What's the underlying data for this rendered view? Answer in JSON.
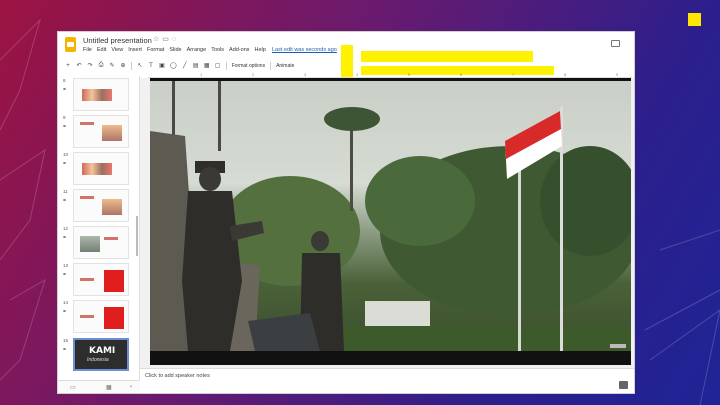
{
  "window": {
    "doc_title": "Untitled presentation",
    "title_icons": [
      "star-icon",
      "folder-icon",
      "cloud-icon"
    ],
    "last_edit": "Last edit was seconds ago"
  },
  "menu": [
    "File",
    "Edit",
    "View",
    "Insert",
    "Format",
    "Slide",
    "Arrange",
    "Tools",
    "Add-ons",
    "Help"
  ],
  "toolbar": {
    "format_options": "Format options",
    "animate": "Animate"
  },
  "ruler": [
    "1",
    "2",
    "3",
    "4",
    "5",
    "6",
    "7",
    "8",
    "9"
  ],
  "filmstrip": {
    "slides": [
      {
        "num": "8",
        "kind": "figures"
      },
      {
        "num": "9",
        "kind": "text-figure"
      },
      {
        "num": "10",
        "kind": "figures"
      },
      {
        "num": "11",
        "kind": "text-figure"
      },
      {
        "num": "12",
        "kind": "photo-text"
      },
      {
        "num": "13",
        "kind": "red-card"
      },
      {
        "num": "14",
        "kind": "red-card"
      },
      {
        "num": "15",
        "kind": "kami",
        "title": "KAMI",
        "subtitle": "Indonesia"
      }
    ]
  },
  "main": {
    "speaker_notes": "Click to add speaker notes"
  },
  "colors": {
    "highlight": "#fff200",
    "flag_red": "#d92a2a",
    "accent_square": "#ffe600"
  }
}
